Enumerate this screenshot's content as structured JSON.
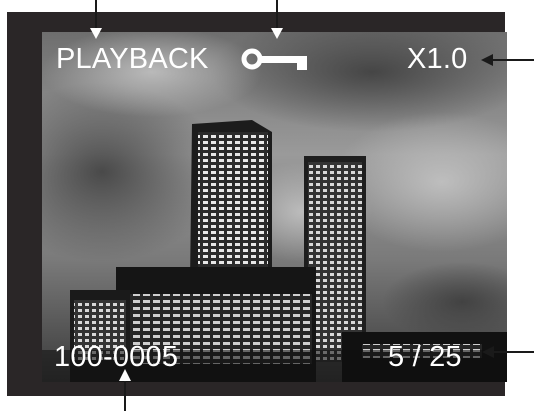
{
  "osd": {
    "mode": "PLAYBACK",
    "zoom": "X1.0",
    "file_number": "100-0005",
    "frame_counter": "5 / 25"
  },
  "icons": {
    "protect": "key-icon"
  },
  "colors": {
    "frame": "#2a2627",
    "osd_text": "#ffffff",
    "callout_lines": "#1a1a1a"
  }
}
